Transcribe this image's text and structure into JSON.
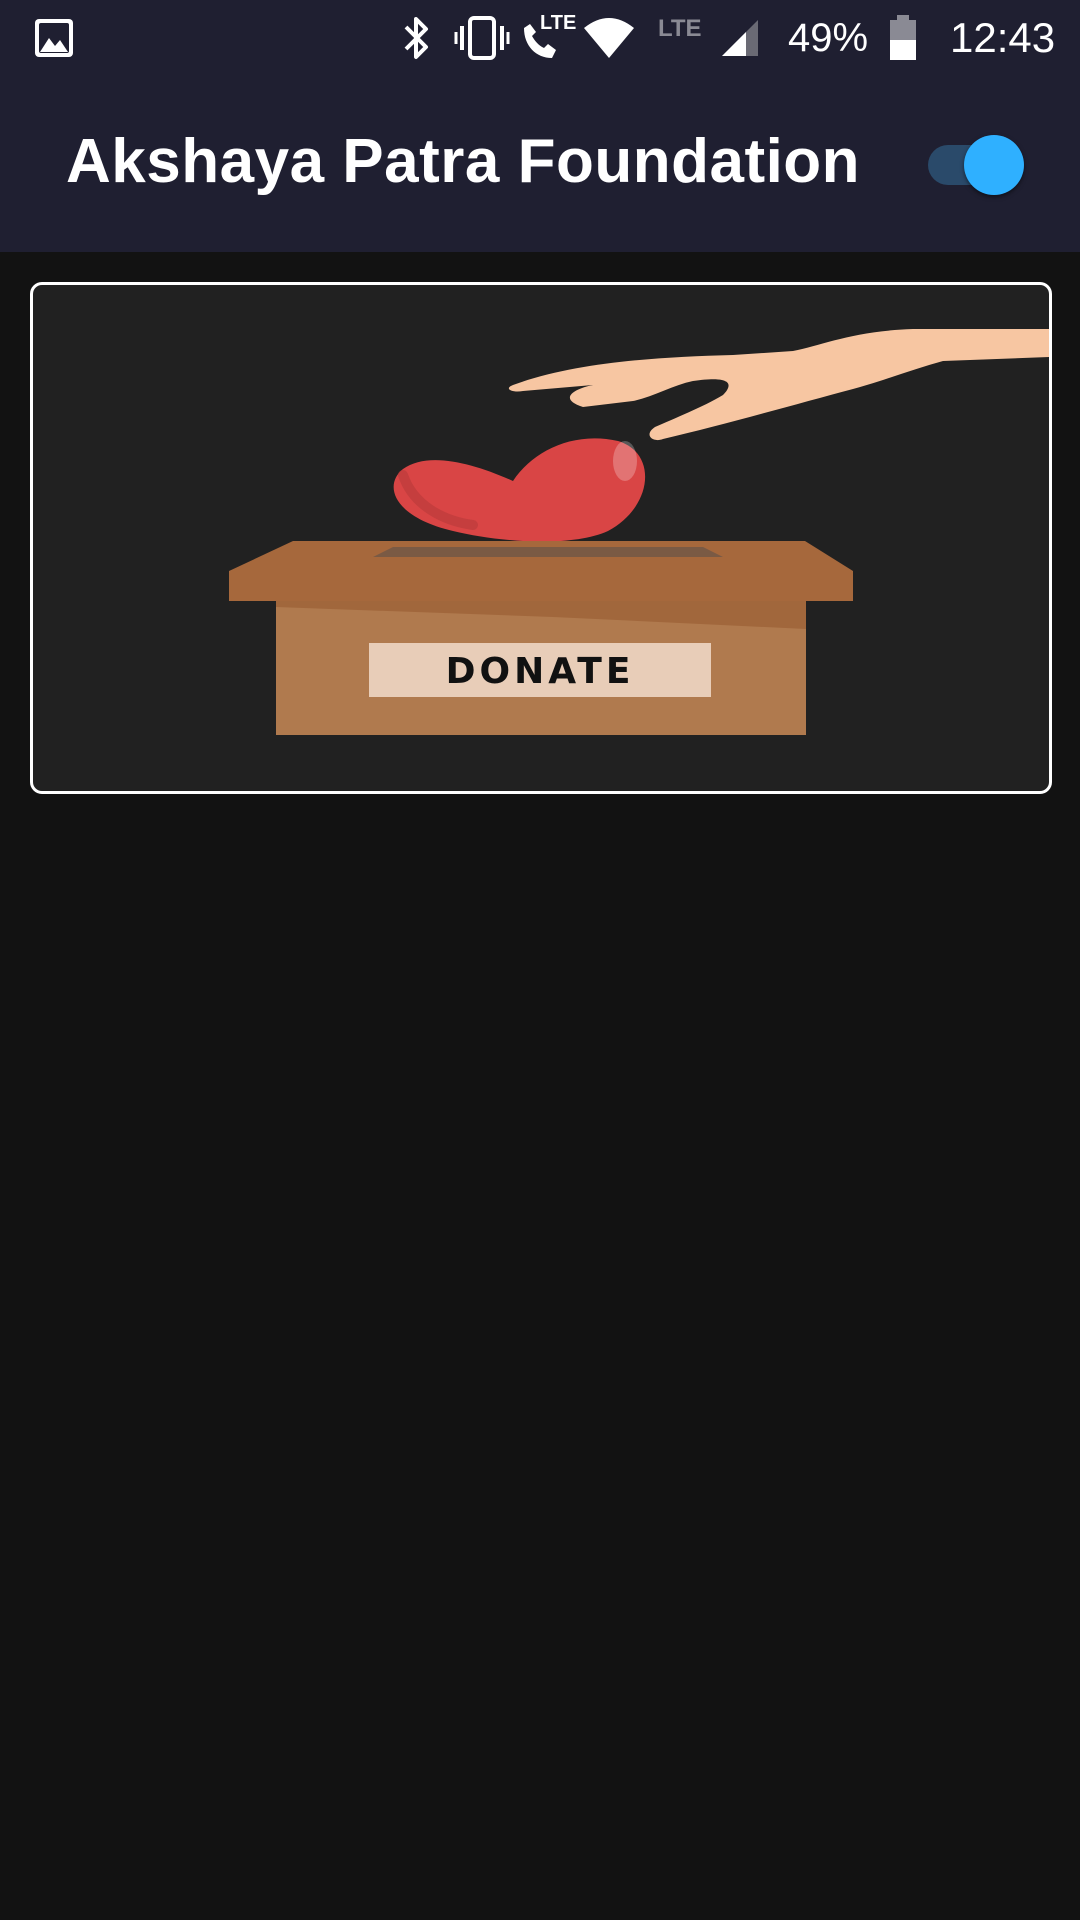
{
  "status_bar": {
    "battery_percent": "49%",
    "time": "12:43",
    "call_lte": "LTE",
    "data_lte": "LTE",
    "icons": [
      "gallery-icon",
      "bluetooth-icon",
      "vibrate-icon",
      "lte-call-icon",
      "wifi-icon",
      "lte-data-icon",
      "signal-icon",
      "battery-icon"
    ]
  },
  "app_bar": {
    "title": "Akshaya Patra Foundation",
    "toggle_on": true
  },
  "card": {
    "image_label": "DONATE"
  },
  "colors": {
    "bar_background": "#1f1f31",
    "page_background": "#121212",
    "card_background": "#212121",
    "toggle_track": "#2a4a6a",
    "toggle_thumb": "#2fb0ff",
    "heart": "#d94545",
    "box": "#b07a4e",
    "hand": "#f7c6a2"
  }
}
